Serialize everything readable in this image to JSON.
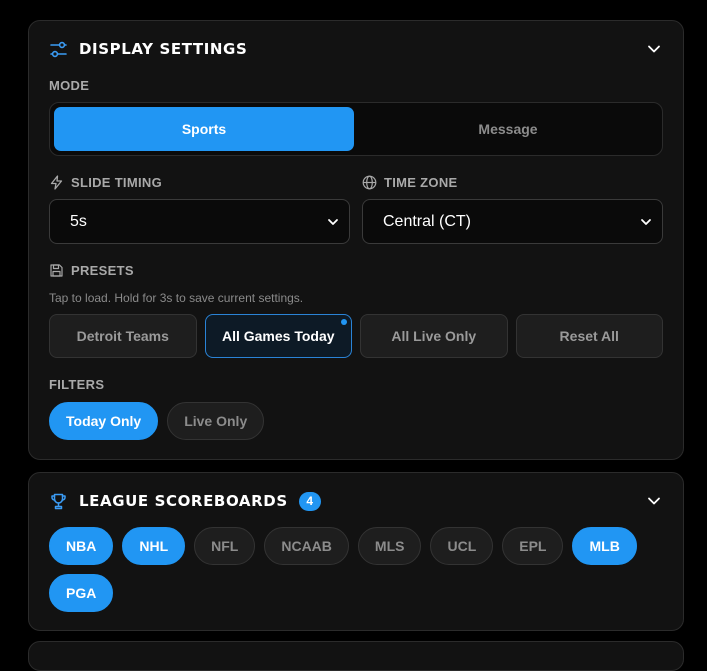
{
  "display_settings": {
    "title": "DISPLAY SETTINGS",
    "header_icon": "sliders-icon",
    "collapse_icon": "chevron-down-icon",
    "mode": {
      "label": "MODE",
      "options": [
        "Sports",
        "Message"
      ],
      "selected": "Sports"
    },
    "slide_timing": {
      "label": "SLIDE TIMING",
      "icon": "lightning-icon",
      "value": "5s"
    },
    "time_zone": {
      "label": "TIME ZONE",
      "icon": "globe-icon",
      "value": "Central (CT)"
    },
    "presets": {
      "label": "PRESETS",
      "icon": "save-icon",
      "hint": "Tap to load. Hold for 3s to save current settings.",
      "items": [
        {
          "label": "Detroit Teams",
          "active": false
        },
        {
          "label": "All Games Today",
          "active": true
        },
        {
          "label": "All Live Only",
          "active": false
        },
        {
          "label": "Reset All",
          "active": false
        }
      ]
    },
    "filters": {
      "label": "FILTERS",
      "items": [
        {
          "label": "Today Only",
          "active": true
        },
        {
          "label": "Live Only",
          "active": false
        }
      ]
    }
  },
  "league_scoreboards": {
    "title": "LEAGUE SCOREBOARDS",
    "header_icon": "trophy-icon",
    "badge": "4",
    "leagues": [
      {
        "label": "NBA",
        "active": true
      },
      {
        "label": "NHL",
        "active": true
      },
      {
        "label": "NFL",
        "active": false
      },
      {
        "label": "NCAAB",
        "active": false
      },
      {
        "label": "MLS",
        "active": false
      },
      {
        "label": "UCL",
        "active": false
      },
      {
        "label": "EPL",
        "active": false
      },
      {
        "label": "MLB",
        "active": true
      },
      {
        "label": "PGA",
        "active": true
      }
    ]
  },
  "colors": {
    "accent": "#2196f3",
    "card_bg": "#121212",
    "page_bg": "#000000"
  }
}
